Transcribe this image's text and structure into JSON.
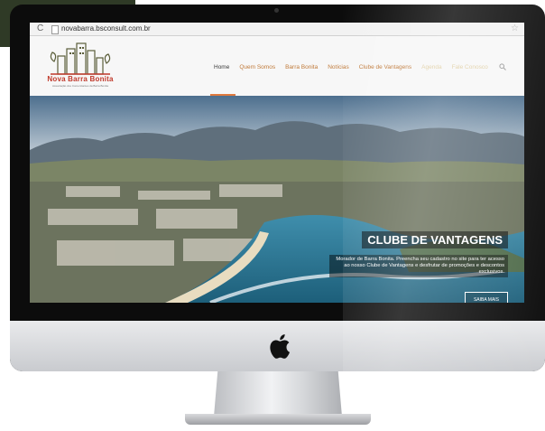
{
  "browser": {
    "url": "novabarra.bsconsult.com.br",
    "reload_icon": "reload-icon",
    "star_icon": "bookmark-star-icon"
  },
  "logo": {
    "title": "Nova Barra Bonita",
    "subtitle": "Associação dos Comerciantes da Barra Bonita"
  },
  "nav": {
    "items": [
      {
        "label": "Home"
      },
      {
        "label": "Quem Somos"
      },
      {
        "label": "Barra Bonita"
      },
      {
        "label": "Notícias"
      },
      {
        "label": "Clube de Vantagens"
      },
      {
        "label": "Agenda"
      },
      {
        "label": "Fale Conosco"
      }
    ],
    "search_icon": "search-icon",
    "active_color": "#e07a3e"
  },
  "hero": {
    "title": "CLUBE DE VANTAGENS",
    "text": "Morador de Barra Bonita. Preencha seu cadastro no site para ter acesso ao nosso Clube de Vantagens e desfrutar de promoções e descontos exclusivos.",
    "button": "SAIBA MAIS"
  },
  "device": {
    "logo_icon": "apple-logo-icon"
  }
}
